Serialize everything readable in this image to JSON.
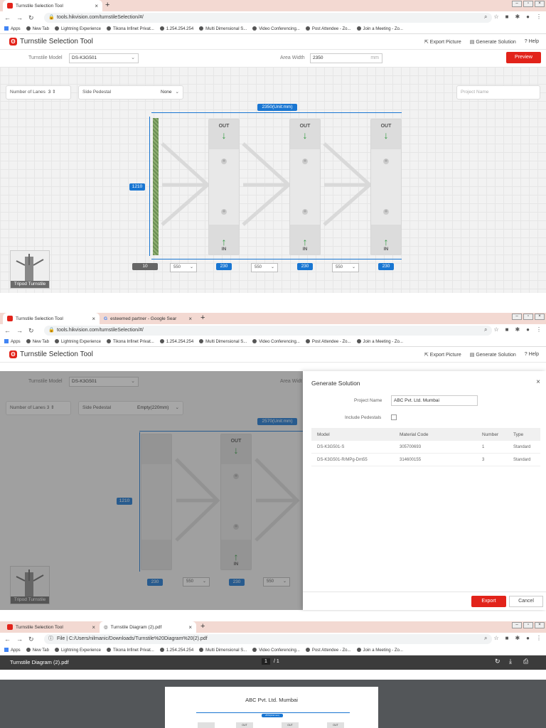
{
  "browser1": {
    "tab1": "Turnstile Selection Tool",
    "url": "tools.hikvision.com/turnstileSelection/#/",
    "bookmarks": [
      "Apps",
      "New Tab",
      "Lightning Experience",
      "Tikona Infinet Privat...",
      "1.254.254.254",
      "Multi Dimensional S...",
      "Video Conferencing...",
      "Post Attendee - Zo...",
      "Join a Meeting - Zo..."
    ]
  },
  "browser2": {
    "tab1": "Turnstile Selection Tool",
    "tab2": "esteemed partner - Google Sear",
    "url": "tools.hikvision.com/turnstileSelection/#/"
  },
  "browser3": {
    "tab1": "Turnstile Selection Tool",
    "tab2": "Turnstile Diagram (2).pdf",
    "url_prefix": "File",
    "url": "C:/Users/nilmanic/Downloads/Turnstile%20Diagram%20(2).pdf"
  },
  "app": {
    "title": "Turnstile Selection Tool",
    "export_picture": "Export Picture",
    "generate_solution": "Generate Solution",
    "help": "Help",
    "model_label": "Turnstile Model",
    "model_value": "DS-K3G501",
    "area_width_label": "Area Width",
    "area_width_value": "2350",
    "area_width_unit": "mm",
    "preview": "Preview",
    "lanes_label": "Number of Lanes",
    "lanes_value": "3",
    "side_pedestal_label": "Side Pedestal",
    "side_pedestal_value": "None",
    "project_name_placeholder": "Project Name",
    "width_tag": "2350(Unit:mm)",
    "height_tag": "1210",
    "out": "OUT",
    "in": "IN",
    "bottom_tags": [
      "10",
      "550",
      "230",
      "550",
      "230",
      "550",
      "230"
    ],
    "thumb_label": "Tripod Turnstile"
  },
  "app2": {
    "side_pedestal_value": "Empty(220mm)",
    "width_tag": "2570(Unit:mm)",
    "height_tag": "1210",
    "bottom_tags": [
      "230",
      "550",
      "230",
      "550"
    ],
    "area_width_label_partial": "Area Widt"
  },
  "solution": {
    "title": "Generate Solution",
    "project_name_label": "Project Name",
    "project_name_value": "ABC Pvt. Ltd. Mumbai",
    "include_pedestals": "Include Pedestals",
    "columns": [
      "Model",
      "Material Code",
      "Number",
      "Type"
    ],
    "rows": [
      [
        "DS-K3G501-S",
        "305700693",
        "1",
        "Standard"
      ],
      [
        "DS-K3G501-R/MPg-Dm55",
        "314600155",
        "3",
        "Standard"
      ]
    ],
    "export": "Export",
    "cancel": "Cancel"
  },
  "pdf": {
    "title": "Turnstile Diagram (2).pdf",
    "page": "1",
    "pages": "/ 1",
    "doc_title": "ABC Pvt. Ltd. Mumbai",
    "mini_tag": "2570(Unit:mm)",
    "mini_out": "OUT"
  },
  "colors": {
    "brand": "#e2231a",
    "accent": "#1976d2",
    "arrow": "#2e9a3e"
  }
}
